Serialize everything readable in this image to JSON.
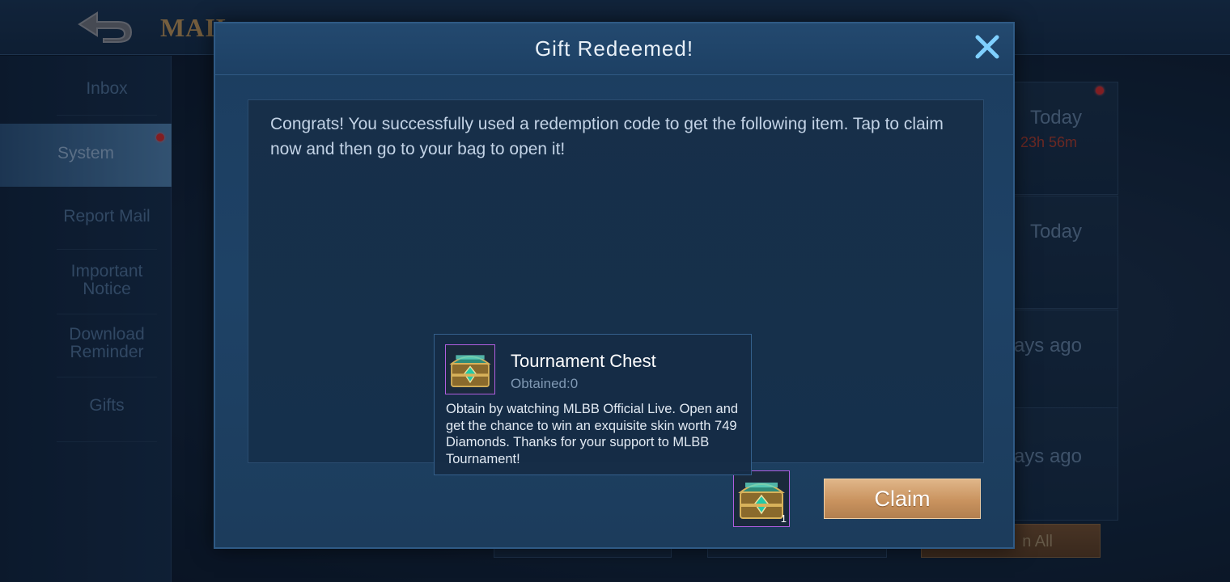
{
  "header": {
    "title": "MAIL"
  },
  "sidebar": {
    "items": [
      {
        "label": "Inbox"
      },
      {
        "label": "System"
      },
      {
        "label": "Report Mail"
      },
      {
        "label": "Important Notice"
      },
      {
        "label": "Download Reminder"
      },
      {
        "label": "Gifts"
      }
    ]
  },
  "mail_list": [
    {
      "date": "Today",
      "timer": "23h 56m"
    },
    {
      "date": "Today",
      "timer": ""
    },
    {
      "date": "ays ago",
      "timer": ""
    },
    {
      "date": "ays ago",
      "timer": ""
    }
  ],
  "footer": {
    "claim_all_label": "n All"
  },
  "modal": {
    "title": "Gift Redeemed!",
    "message": "Congrats! You successfully used a redemption code to get the following item. Tap to claim now and then go to your bag to open it!",
    "claim_label": "Claim",
    "item": {
      "quantity": "1",
      "icon": "tournament-chest-icon"
    }
  },
  "tooltip": {
    "name": "Tournament Chest",
    "obtained": "Obtained:0",
    "description": "Obtain by watching MLBB Official Live. Open and get the chance to win an exquisite skin worth 749 Diamonds. Thanks for your support to MLBB Tournament!"
  },
  "colors": {
    "modal_bg": "#1e4266",
    "claim_button": "#c9935f",
    "item_border": "#b05ee0",
    "timer_red": "#a43a2c",
    "notification_dot": "#c52a2a"
  }
}
